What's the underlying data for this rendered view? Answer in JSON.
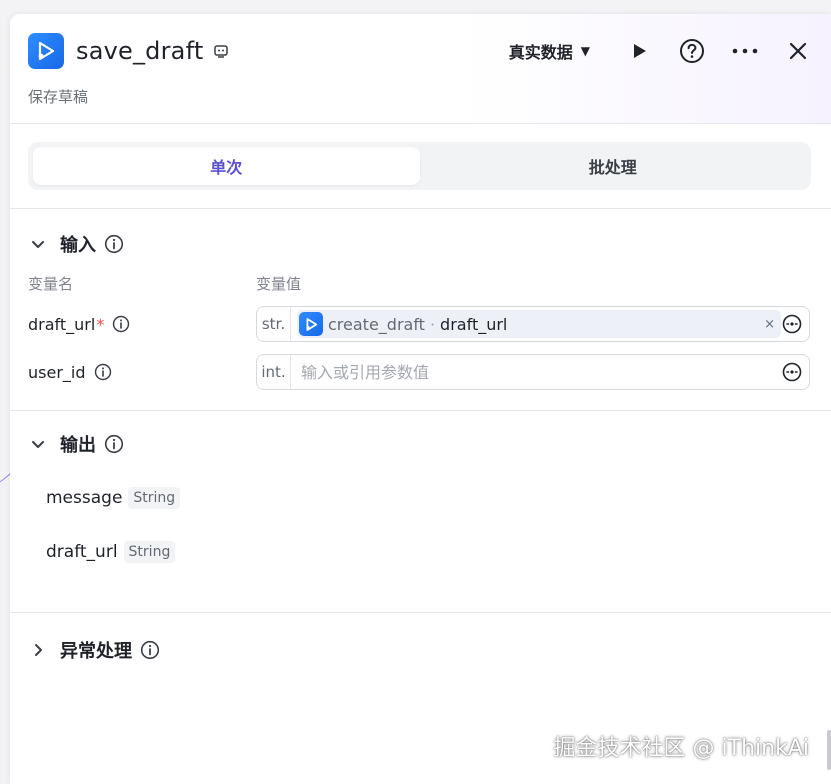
{
  "header": {
    "title": "save_draft",
    "subtitle": "保存草稿",
    "data_mode": "真实数据"
  },
  "tabs": [
    {
      "label": "单次",
      "active": true
    },
    {
      "label": "批处理",
      "active": false
    }
  ],
  "input": {
    "title": "输入",
    "col_name": "变量名",
    "col_value": "变量值",
    "vars": [
      {
        "name": "draft_url",
        "required_mark": "*",
        "type": "str.",
        "ref_node": "create_draft",
        "ref_sep": "·",
        "ref_field": "draft_url",
        "clear_glyph": "×"
      },
      {
        "name": "user_id",
        "type": "int.",
        "placeholder": "输入或引用参数值"
      }
    ]
  },
  "output": {
    "title": "输出",
    "items": [
      {
        "name": "message",
        "type": "String"
      },
      {
        "name": "draft_url",
        "type": "String"
      }
    ]
  },
  "error_handling": {
    "title": "异常处理"
  },
  "watermark": "掘金技术社区 @ iThinkAi",
  "colors": {
    "accent": "#5a4fd6",
    "brand_blue": "#1769e8",
    "required": "#f54a45"
  }
}
